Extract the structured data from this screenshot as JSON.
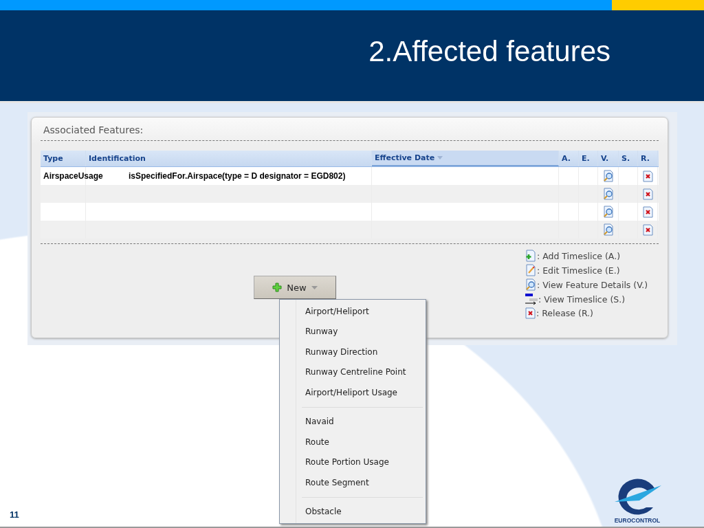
{
  "slide": {
    "title": "2.Affected features",
    "page_number": "11",
    "logo_text": "EUROCONTROL"
  },
  "panel": {
    "title": "Associated Features:"
  },
  "table": {
    "columns": [
      {
        "label": "Type"
      },
      {
        "label": "Identification"
      },
      {
        "label": "Effective Date",
        "sorted": true
      },
      {
        "label": "A."
      },
      {
        "label": "E."
      },
      {
        "label": "V."
      },
      {
        "label": "S."
      },
      {
        "label": "R."
      }
    ],
    "rows": [
      {
        "type": "AirspaceUsage",
        "identification": "isSpecifiedFor.Airspace(type = D designator = EGD802)"
      },
      {},
      {},
      {}
    ]
  },
  "new_button": {
    "label": "New"
  },
  "legend": [
    {
      "kind": "add",
      "text": ": Add Timeslice (A.)"
    },
    {
      "kind": "edit",
      "text": ": Edit Timeslice (E.)"
    },
    {
      "kind": "view",
      "text": ": View Feature Details (V.)"
    },
    {
      "kind": "timeslice",
      "text": ": View Timeslice (S.)"
    },
    {
      "kind": "release",
      "text": ": Release (R.)"
    }
  ],
  "menu": {
    "groups": [
      [
        "Airport/Heliport",
        "Runway",
        "Runway Direction",
        "Runway Centreline Point",
        "Airport/Heliport Usage"
      ],
      [
        "Navaid",
        "Route",
        "Route Portion Usage",
        "Route Segment"
      ],
      [
        "Obstacle"
      ]
    ]
  }
}
